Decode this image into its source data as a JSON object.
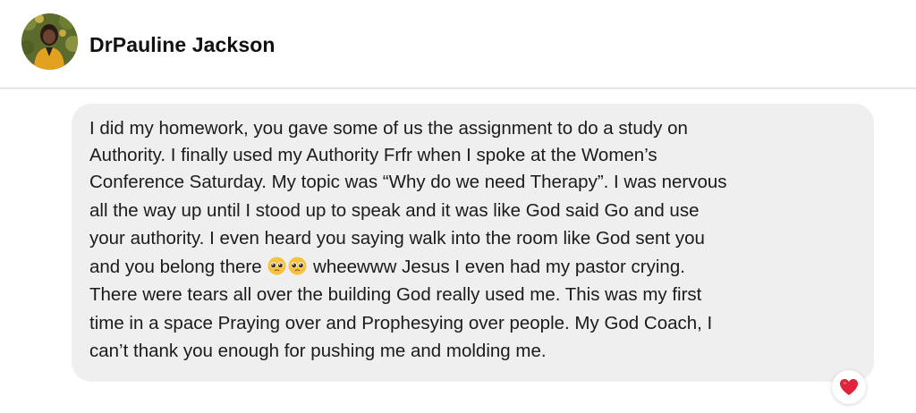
{
  "header": {
    "contact_name": "DrPauline Jackson"
  },
  "message": {
    "line1": "I did my homework, you gave some of us the assignment to do a study on",
    "line2": "Authority. I finally used my Authority Frfr  when I spoke at the Women’s",
    "line3": "Conference Saturday. My topic was “Why do we need Therapy”. I was nervous",
    "line4": "all the way up until I stood up to speak and it was like God said Go and use",
    "line5": "your authority. I even heard you saying walk into the room like God sent you",
    "line6_before_emoji": "and you belong there",
    "line6_after_emoji": "wheewww Jesus I even had my pastor crying.",
    "line7": "There were tears all over the building God really used me. This was my first",
    "line8": "time in a space Praying over and Prophesying over people. My God Coach, I",
    "line9": "can’t thank you enough for pushing me and molding me.",
    "emojis": [
      "pleading-face-emoji",
      "pleading-face-emoji"
    ]
  },
  "reaction": {
    "icon": "heart-icon",
    "color": "#e0243a"
  },
  "colors": {
    "bubble_background": "#efefef",
    "text": "#1b1b1b",
    "page_background": "#ffffff"
  }
}
